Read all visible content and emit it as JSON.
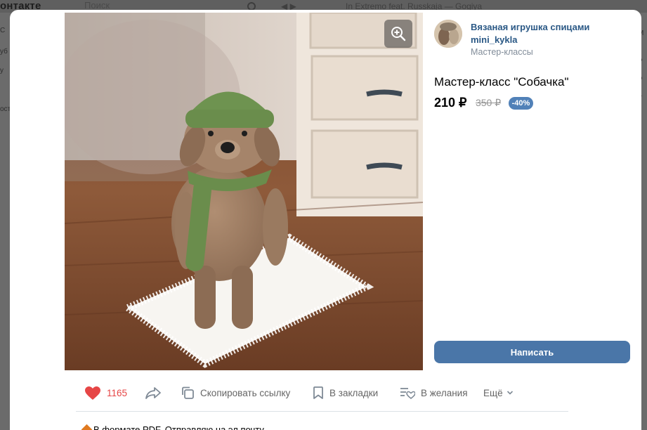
{
  "background": {
    "logo": "онтакте",
    "search_placeholder": "Поиск",
    "player_title": "In Extremo feat. Russkaja — Gogiya",
    "left_fragments": [
      "С",
      "уб",
      "у",
      "ост"
    ],
    "right_fragments": [
      "М",
      "Р",
      "Р",
      "Т"
    ]
  },
  "thumbnails": [
    {
      "label": "video-thumb",
      "kind": "video"
    },
    {
      "label": "photo-thumb-1",
      "kind": "photo"
    },
    {
      "label": "photo-thumb-2",
      "kind": "photo"
    },
    {
      "label": "photo-thumb-3",
      "kind": "photo"
    },
    {
      "label": "photo-thumb-4",
      "kind": "photo"
    },
    {
      "label": "photo-thumb-5",
      "kind": "photo"
    }
  ],
  "shop": {
    "name": "Вязаная игрушка спицами mini_kykla",
    "category": "Мастер-классы"
  },
  "product": {
    "title": "Мастер-класс \"Собачка\"",
    "price": "210 ₽",
    "old_price": "350 ₽",
    "discount": "-40%",
    "write_label": "Написать"
  },
  "actions": {
    "likes": "1165",
    "copy_link": "Скопировать ссылку",
    "bookmarks": "В закладки",
    "wishlist": "В желания",
    "more": "Ещё"
  },
  "description_start": "В формате PDF. Отправляю на эл.почту",
  "colors": {
    "accent": "#4a76a8",
    "link": "#2a5885",
    "like": "#e64646",
    "discount_badge": "#5181b8"
  }
}
